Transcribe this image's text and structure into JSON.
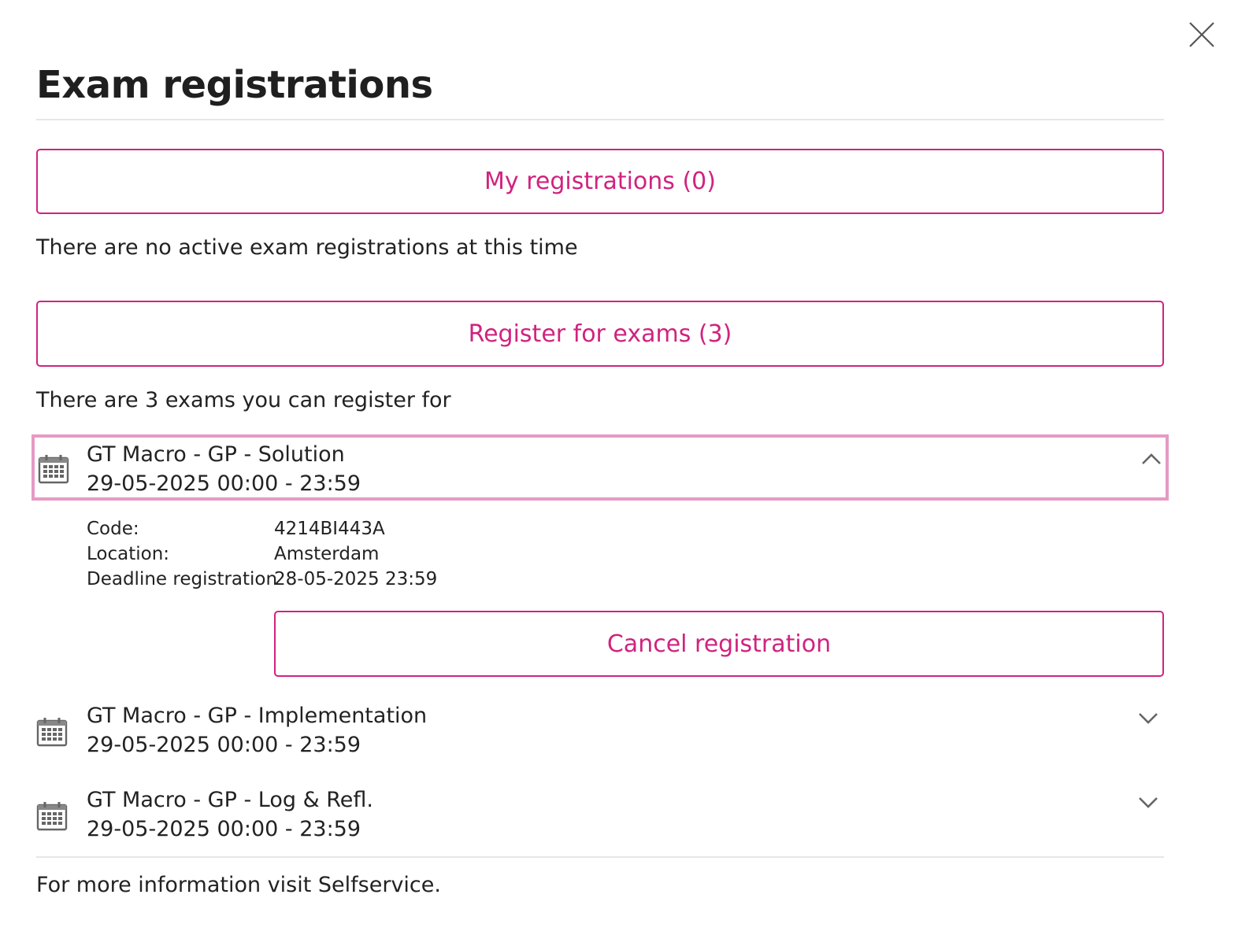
{
  "title": "Exam registrations",
  "my_registrations_button": "My registrations (0)",
  "no_registrations_text": "There are no active exam registrations at this time",
  "register_button": "Register for exams (3)",
  "can_register_text": "There are 3 exams you can register for",
  "exams": [
    {
      "name": "GT Macro - GP - Solution",
      "datetime": "29-05-2025 00:00 - 23:59",
      "expanded": true,
      "details": {
        "code_label": "Code:",
        "code_value": "4214BI443A",
        "location_label": "Location:",
        "location_value": "Amsterdam",
        "deadline_label": "Deadline registration",
        "deadline_value": "28-05-2025 23:59"
      },
      "action_button": "Cancel registration"
    },
    {
      "name": "GT Macro - GP - Implementation",
      "datetime": "29-05-2025 00:00 - 23:59",
      "expanded": false
    },
    {
      "name": "GT Macro - GP - Log & Refl.",
      "datetime": "29-05-2025 00:00 - 23:59",
      "expanded": false
    }
  ],
  "footer_text": "For more information visit Selfservice.",
  "icons": {
    "close": "close-icon",
    "calendar": "calendar-icon",
    "chevron_up": "chevron-up-icon",
    "chevron_down": "chevron-down-icon"
  },
  "colors": {
    "accent": "#d0237f",
    "active_border": "#e59ac4",
    "text": "#222222",
    "divider": "#e6e6e6"
  }
}
